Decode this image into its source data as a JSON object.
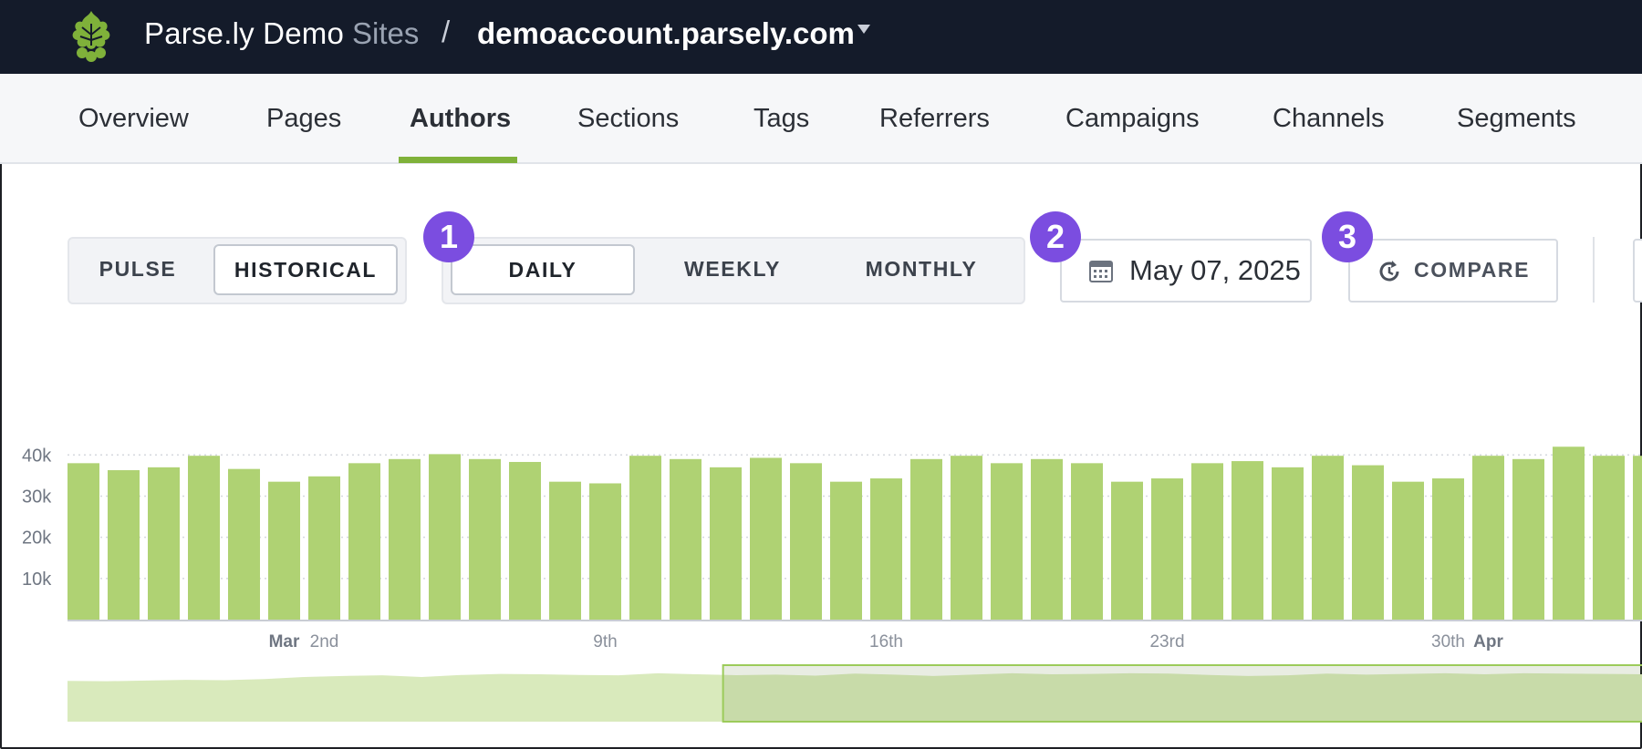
{
  "header": {
    "brand": "Parse.ly Demo",
    "sites_label": "Sites",
    "separator": "/",
    "domain": "demoaccount.parsely.com"
  },
  "nav": {
    "tabs": [
      {
        "label": "Overview"
      },
      {
        "label": "Pages"
      },
      {
        "label": "Authors",
        "active": true
      },
      {
        "label": "Sections"
      },
      {
        "label": "Tags"
      },
      {
        "label": "Referrers"
      },
      {
        "label": "Campaigns"
      },
      {
        "label": "Channels"
      },
      {
        "label": "Segments"
      }
    ]
  },
  "controls": {
    "mode": {
      "options": [
        "PULSE",
        "HISTORICAL"
      ],
      "selected": "HISTORICAL"
    },
    "period": {
      "options": [
        "DAILY",
        "WEEKLY",
        "MONTHLY"
      ],
      "selected": "DAILY"
    },
    "date": "May 07, 2025",
    "compare_label": "COMPARE",
    "badges": [
      "1",
      "2",
      "3"
    ]
  },
  "colors": {
    "accent": "#7fb13a",
    "bar": "#afd273",
    "badge": "#7b4de0",
    "topbar": "#141b2a"
  },
  "chart_data": {
    "type": "bar",
    "y_ticks": [
      "40k",
      "30k",
      "20k",
      "10k"
    ],
    "ylim": [
      0,
      42500
    ],
    "x_labels": [
      {
        "label": "Mar",
        "index": 5,
        "bold": true
      },
      {
        "label": "2nd",
        "index": 6
      },
      {
        "label": "9th",
        "index": 13
      },
      {
        "label": "16th",
        "index": 20
      },
      {
        "label": "23rd",
        "index": 27
      },
      {
        "label": "30th",
        "index": 34
      },
      {
        "label": "Apr",
        "index": 35,
        "bold": true
      }
    ],
    "values": [
      38000,
      36300,
      37000,
      39800,
      36600,
      33500,
      34800,
      38000,
      39000,
      40200,
      39000,
      38300,
      33500,
      33100,
      39800,
      39000,
      37000,
      39300,
      38000,
      33500,
      34300,
      39000,
      39800,
      38000,
      39000,
      38000,
      33500,
      34300,
      38000,
      38500,
      37000,
      39800,
      37500,
      33500,
      34300,
      39800,
      39000,
      42000,
      39800,
      39800
    ],
    "overview_values": [
      34000,
      33800,
      34200,
      34600,
      34400,
      35000,
      36200,
      36800,
      37200,
      36200,
      37400,
      38000,
      37800,
      37400,
      37200,
      38400,
      37800,
      37300,
      37600,
      37000,
      38200,
      37600,
      36800,
      37600,
      38400,
      37800,
      38000,
      38400,
      38200,
      37400,
      36800,
      37200,
      38200,
      37600,
      38000,
      38400,
      37800,
      38400,
      38200,
      38000,
      37800
    ],
    "overview_range": {
      "start": 0.37,
      "end": 1.0
    }
  }
}
